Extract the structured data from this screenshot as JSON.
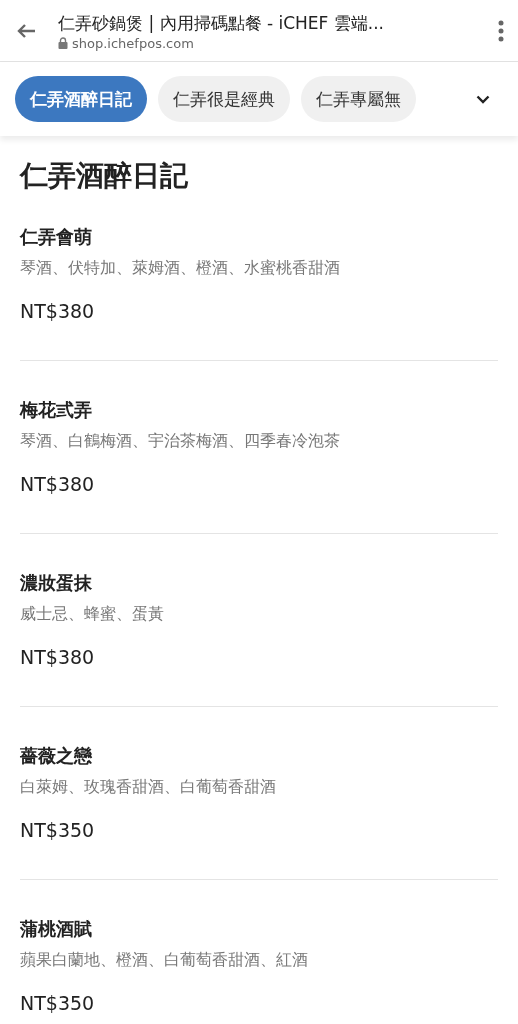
{
  "browser": {
    "title": "仁弄砂鍋煲 | 內用掃碼點餐 - iCHEF 雲端...",
    "url": "shop.ichefpos.com"
  },
  "tabs": [
    {
      "label": "仁弄酒醉日記",
      "selected": true
    },
    {
      "label": "仁弄很是經典",
      "selected": false
    },
    {
      "label": "仁弄專屬無",
      "selected": false
    }
  ],
  "section": {
    "title": "仁弄酒醉日記"
  },
  "items": [
    {
      "name": "仁弄會萌",
      "description": "琴酒、伏特加、萊姆酒、橙酒、水蜜桃香甜酒",
      "price": "NT$380"
    },
    {
      "name": "梅花弎弄",
      "description": "琴酒、白鶴梅酒、宇治茶梅酒、四季春冷泡茶",
      "price": "NT$380"
    },
    {
      "name": "濃妝蛋抹",
      "description": "威士忌、蜂蜜、蛋黃",
      "price": "NT$380"
    },
    {
      "name": "薔薇之戀",
      "description": "白萊姆、玫瑰香甜酒、白葡萄香甜酒",
      "price": "NT$350"
    },
    {
      "name": "蒲桃酒賦",
      "description": "蘋果白蘭地、橙酒、白葡萄香甜酒、紅酒",
      "price": "NT$350"
    }
  ]
}
